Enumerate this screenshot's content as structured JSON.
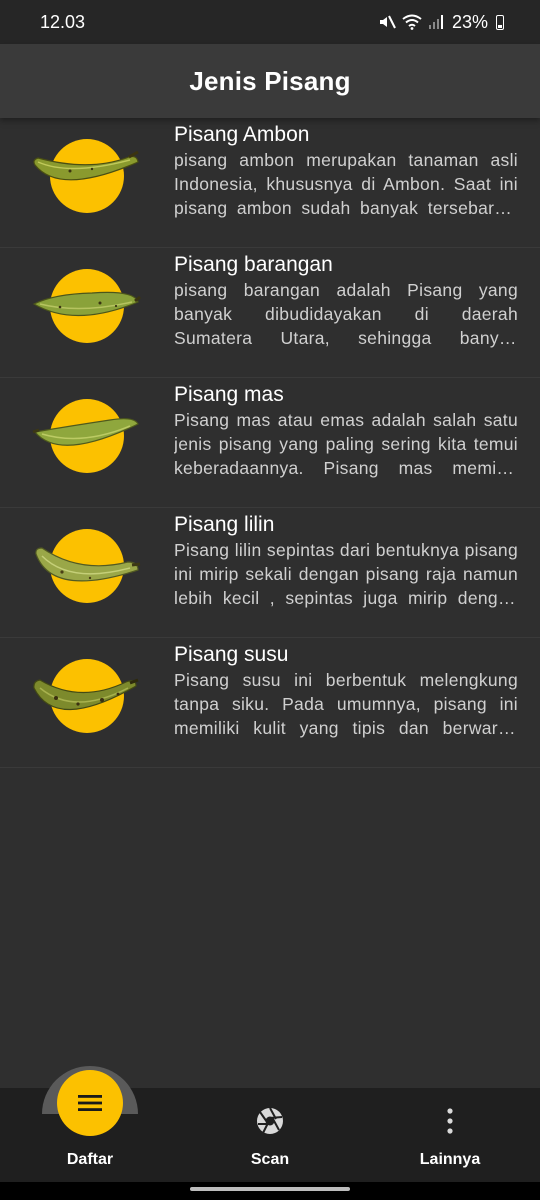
{
  "status_bar": {
    "time": "12.03",
    "battery_text": "23%",
    "icons": [
      "mute-icon",
      "wifi-icon",
      "signal-icon",
      "battery-icon"
    ]
  },
  "app_bar": {
    "title": "Jenis Pisang"
  },
  "bananas": [
    {
      "title": "Pisang Ambon",
      "description": "pisang ambon merupakan tanaman asli Indonesia, khususnya di Ambon. Saat ini pisang ambon sudah banyak tersebar di berbagai daerah di Indonesia.",
      "image": "banana-ambon-image"
    },
    {
      "title": "Pisang barangan",
      "description": "pisang barangan adalah Pisang yang banyak dibudidayakan di daerah Sumatera Utara, sehingga banyak dijumpai di pasar-pasar daerah tersebut.",
      "image": "banana-barangan-image"
    },
    {
      "title": "Pisang mas",
      "description": "Pisang mas atau emas adalah salah satu jenis pisang yang paling sering kita temui keberadaannya. Pisang mas memiliki ukuran yang kecil.",
      "image": "banana-mas-image"
    },
    {
      "title": "Pisang lilin",
      "description": "Pisang lilin sepintas dari bentuknya pisang ini mirip sekali dengan pisang raja namun lebih kecil , sepintas juga mirip dengan pisang mas.",
      "image": "banana-lilin-image"
    },
    {
      "title": "Pisang susu",
      "description": "Pisang susu ini berbentuk melengkung tanpa siku. Pada umumnya, pisang ini memiliki kulit yang tipis dan berwarna kuning saat matang.",
      "image": "banana-susu-image"
    }
  ],
  "bottom_nav": {
    "items": [
      {
        "label": "Daftar",
        "icon": "menu-icon",
        "active": true
      },
      {
        "label": "Scan",
        "icon": "camera-shutter-icon",
        "active": false
      },
      {
        "label": "Lainnya",
        "icon": "more-vertical-icon",
        "active": false
      }
    ]
  },
  "colors": {
    "background": "#2f2f2f",
    "app_bar": "#3a3a3a",
    "accent": "#fcc100",
    "nav_background": "#1f1f1f"
  }
}
